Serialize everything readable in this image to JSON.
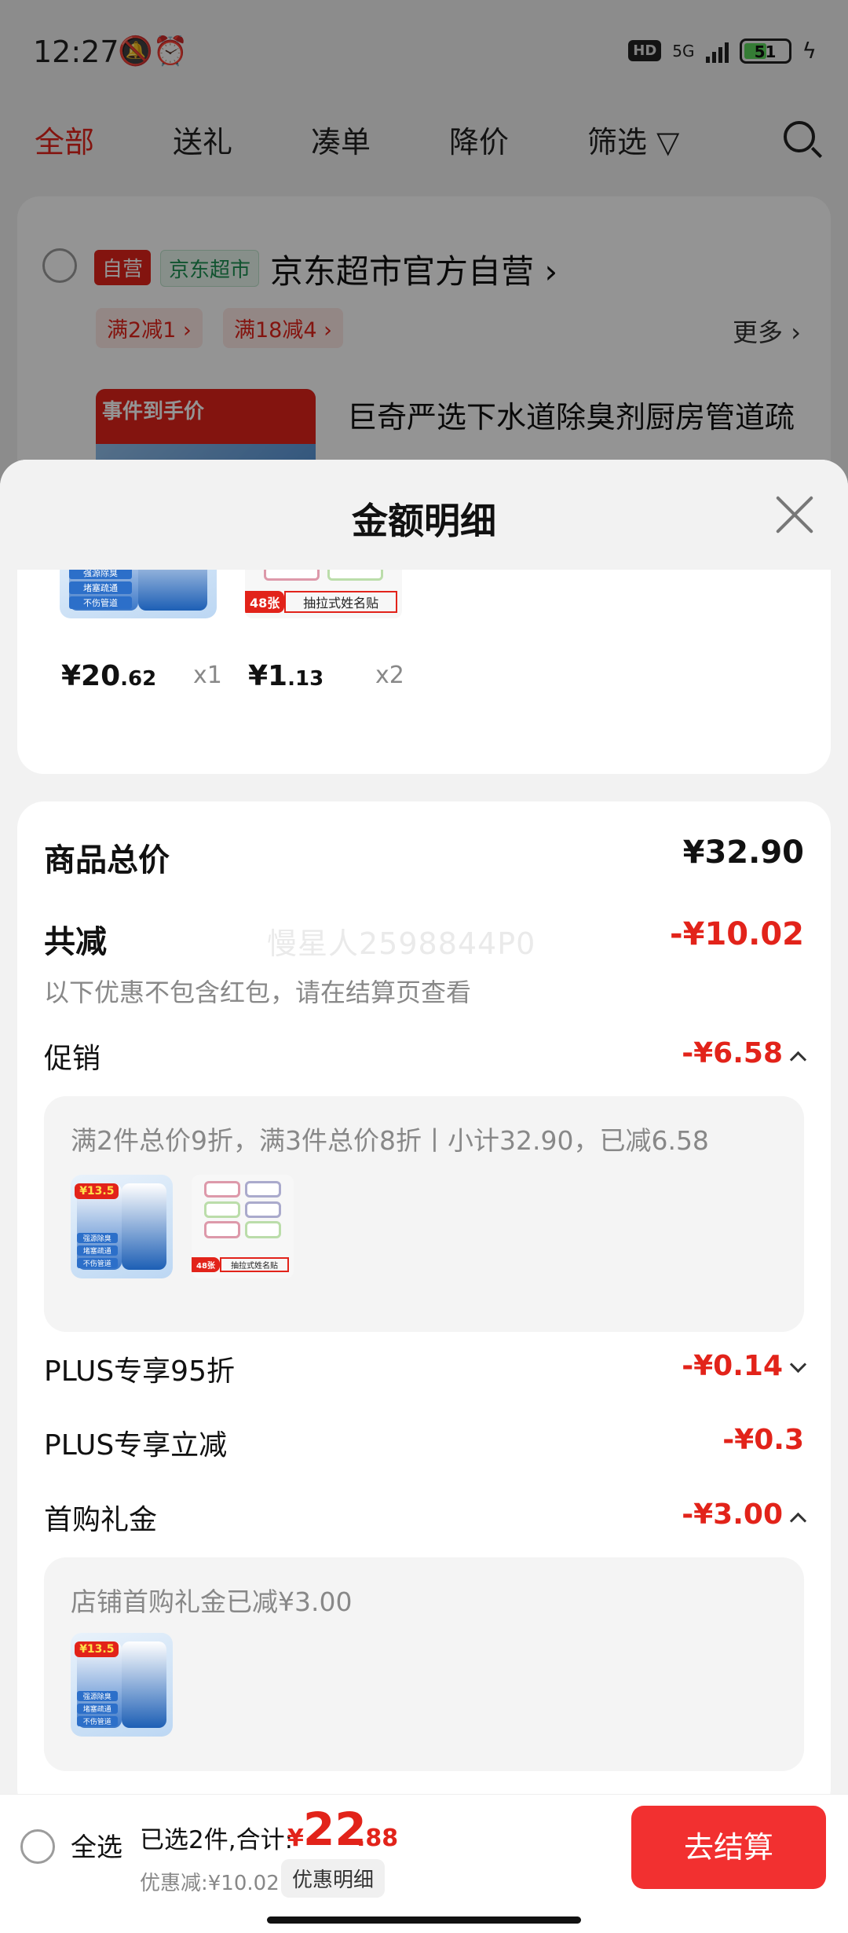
{
  "status_bar": {
    "time": "12:27",
    "icons_left": "🔕⏰",
    "hd": "HD",
    "network": "5G",
    "battery": "51",
    "charging_icon": "ϟ"
  },
  "tabs": [
    {
      "label": "全部",
      "active": true
    },
    {
      "label": "送礼",
      "active": false
    },
    {
      "label": "凑单",
      "active": false
    },
    {
      "label": "降价",
      "active": false
    },
    {
      "label": "筛选 ▽",
      "active": false
    }
  ],
  "shop": {
    "tag_self": "自营",
    "tag_market": "京东超市",
    "name": "京东超市官方自营 ›",
    "promos": [
      "满2减1 ›",
      "满18减4 ›"
    ],
    "more": "更多 ›",
    "product_title": "巨奇严选下水道除臭剂厨房管道疏",
    "product_img_banner": "事件到手价"
  },
  "sheet": {
    "title": "金额明细",
    "items": [
      {
        "price_int": "¥20",
        "price_dec": ".62",
        "qty": "x1",
        "img_badge": "¥13.5",
        "img_lines": [
          "强源除臭",
          "堵塞疏通",
          "不伤管道"
        ]
      },
      {
        "price_int": "¥1",
        "price_dec": ".13",
        "qty": "x2",
        "img_count": "48张",
        "img_caption": "抽拉式姓名贴"
      }
    ],
    "total_label": "商品总价",
    "total_value": "¥32.90",
    "reduce_label": "共减",
    "reduce_value": "-¥10.02",
    "reduce_note": "以下优惠不包含红包，请在结算页查看",
    "watermark": "慢星人2598844P0",
    "promo_label": "促销",
    "promo_value": "-¥6.58",
    "promo_detail": "满2件总价9折，满3件总价8折丨小计32.90，已减6.58",
    "plus95_label": "PLUS专享95折",
    "plus95_value": "-¥0.14",
    "plus_reduce_label": "PLUS专享立减",
    "plus_reduce_value": "-¥0.3",
    "first_label": "首购礼金",
    "first_value": "-¥3.00",
    "first_detail": "店铺首购礼金已减¥3.00"
  },
  "bottom_bar": {
    "select_all": "全选",
    "sum_label": "已选2件,合计:",
    "sum_currency": "¥",
    "sum_int": "22",
    "sum_dec": ".88",
    "discount_label": "优惠减:¥10.02",
    "discount_button": "优惠明细",
    "checkout": "去结算"
  },
  "colors": {
    "accent": "#e2231a",
    "checkout": "#f23030"
  }
}
